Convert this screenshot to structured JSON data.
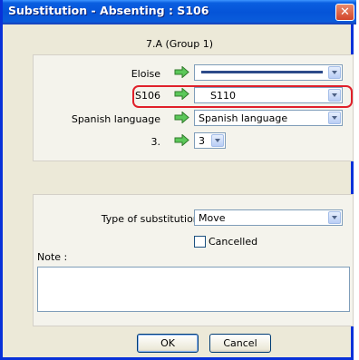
{
  "window": {
    "title": "Substitution - Absenting : S106",
    "close_symbol": "✕"
  },
  "group_caption": "7.A (Group 1)",
  "rows": [
    {
      "label": "Eloise",
      "value": ""
    },
    {
      "label": "S106",
      "value": "S110"
    },
    {
      "label": "Spanish language",
      "value": "Spanish language"
    },
    {
      "label": "3.",
      "value": "3"
    }
  ],
  "substitution": {
    "type_label": "Type of substitution :",
    "type_value": "Move",
    "cancelled_label": "Cancelled",
    "cancelled_checked": false,
    "note_label": "Note :",
    "note_value": ""
  },
  "buttons": {
    "ok": "OK",
    "cancel": "Cancel"
  },
  "colors": {
    "arrow_green": "#3cb043",
    "highlight_red": "#e0202a",
    "titlebar_blue": "#0554d8"
  },
  "icons": {
    "arrow": "green-right-arrow-icon",
    "dropdown": "chevron-down-icon",
    "close": "close-icon"
  }
}
